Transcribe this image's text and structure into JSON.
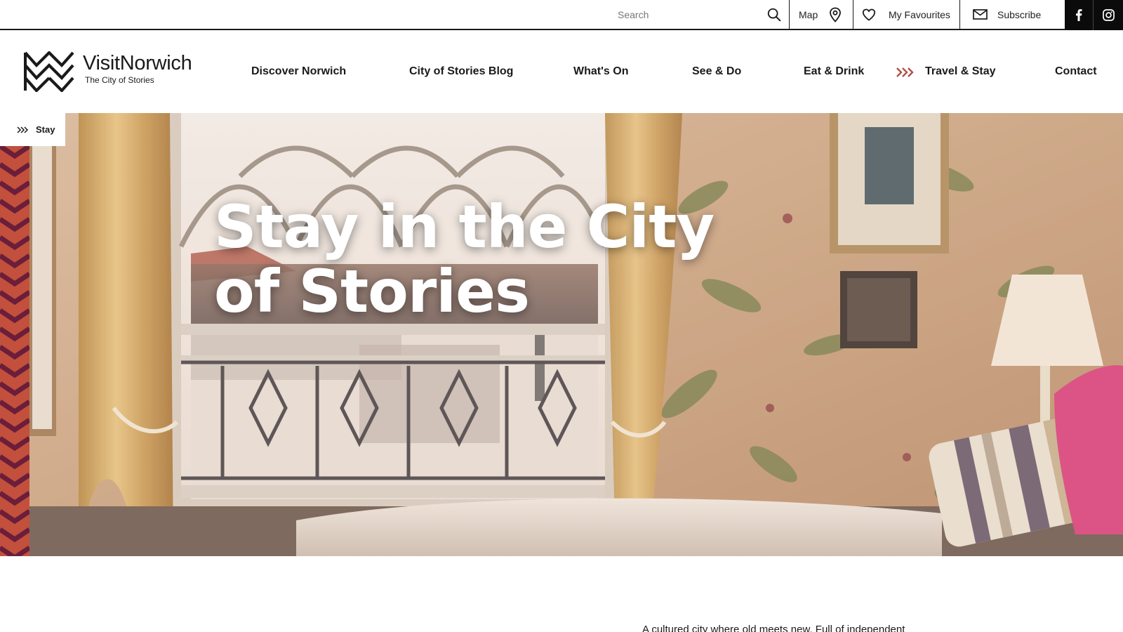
{
  "colors": {
    "brand_dark": "#1a1a1a",
    "accent_red": "#c2503c",
    "accent_plum": "#6b1e3a",
    "social_bg": "#0b0b0b"
  },
  "topbar": {
    "search": {
      "placeholder": "Search",
      "value": "",
      "icon": "search-icon"
    },
    "map": {
      "label": "Map",
      "icon": "map-pin-icon"
    },
    "favourites": {
      "label": "My Favourites",
      "icon": "heart-icon"
    },
    "subscribe": {
      "label": "Subscribe",
      "icon": "envelope-icon"
    },
    "social": [
      {
        "icon": "facebook-icon"
      },
      {
        "icon": "instagram-icon"
      }
    ]
  },
  "header": {
    "logo": {
      "name": "VisitNorwich",
      "tagline": "The City of Stories",
      "icon": "visitnorwich-chevron-logo"
    },
    "nav": [
      {
        "label": "Discover Norwich"
      },
      {
        "label": "City of Stories Blog"
      },
      {
        "label": "What's On"
      },
      {
        "label": "See & Do"
      },
      {
        "label": "Eat & Drink"
      },
      {
        "label": "Travel & Stay",
        "active": true,
        "icon": "triple-chevron-icon"
      },
      {
        "label": "Contact"
      }
    ]
  },
  "breadcrumb": {
    "label": "Stay",
    "icon": "triple-chevron-icon"
  },
  "hero": {
    "title": "Stay in the City of Stories",
    "image": "bedroom-window-with-floral-wallpaper"
  },
  "intro": {
    "text": "A cultured city where old meets new. Full of independent"
  }
}
